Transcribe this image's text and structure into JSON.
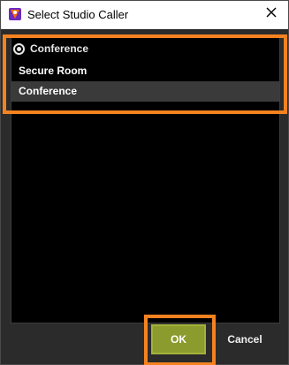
{
  "window": {
    "title": "Select Studio Caller"
  },
  "selection": {
    "current_label": "Conference"
  },
  "options": [
    {
      "label": "Secure Room"
    },
    {
      "label": "Conference"
    }
  ],
  "buttons": {
    "ok_label": "OK",
    "cancel_label": "Cancel"
  },
  "colors": {
    "accent_highlight": "#f58220",
    "ok_button": "#8c9b2d",
    "list_background": "#000000",
    "window_background": "#2b2b2b"
  },
  "icons": {
    "app_icon": "app-icon",
    "close_icon": "close-icon",
    "radio_icon": "radio-selected-icon"
  }
}
